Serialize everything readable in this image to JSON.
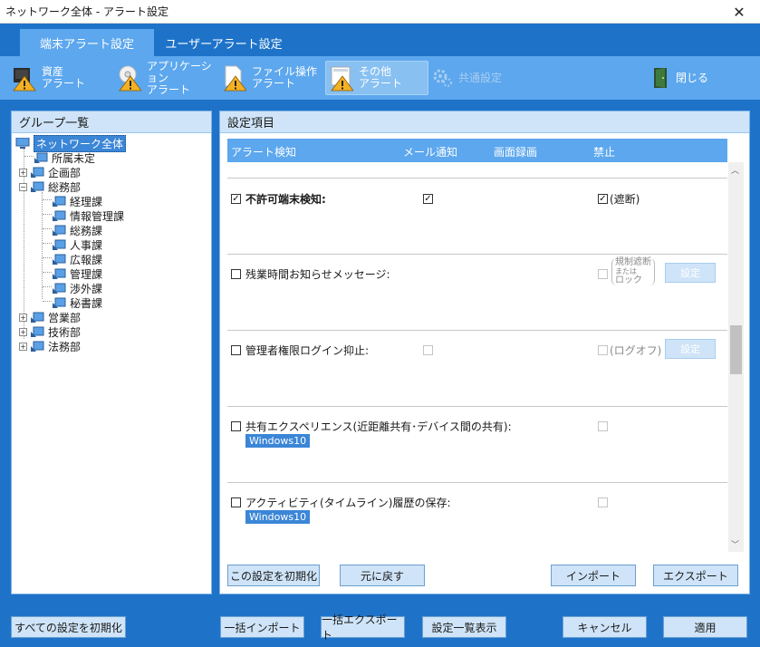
{
  "window": {
    "title": "ネットワーク全体 - アラート設定",
    "close_glyph": "✕"
  },
  "tabs": [
    {
      "label": "端末アラート設定",
      "active": true
    },
    {
      "label": "ユーザーアラート設定",
      "active": false
    }
  ],
  "toolbar": {
    "asset": {
      "line1": "資産",
      "line2": "アラート"
    },
    "application": {
      "line1": "アプリケーション",
      "line2": "アラート"
    },
    "file": {
      "line1": "ファイル操作",
      "line2": "アラート"
    },
    "other": {
      "line1": "その他",
      "line2": "アラート"
    },
    "common": {
      "label": "共通設定"
    },
    "close": {
      "label": "閉じる"
    }
  },
  "left_panel": {
    "title": "グループ一覧",
    "tree": {
      "root": "ネットワーク全体",
      "unassigned": "所属未定",
      "planning": "企画部",
      "general_affairs": "総務部",
      "children": [
        "経理課",
        "情報管理課",
        "総務課",
        "人事課",
        "広報課",
        "管理課",
        "渉外課",
        "秘書課"
      ],
      "sales": "営業部",
      "tech": "技術部",
      "legal": "法務部"
    }
  },
  "right_panel": {
    "title": "設定項目",
    "columns": {
      "alert": "アラート検知",
      "mail": "メール通知",
      "screen": "画面録画",
      "ban": "禁止"
    },
    "rows": [
      {
        "label": "不許可端末検知:",
        "checked": true,
        "mail": true,
        "ban": true,
        "ban_label": "(遮断)"
      },
      {
        "label": "残業時間お知らせメッセージ:",
        "checked": false,
        "lock_line1": "規制遮断",
        "lock_line2": "または",
        "lock_line3": "ロック",
        "button": "設定"
      },
      {
        "label": "管理者権限ログイン抑止:",
        "checked": false,
        "ban_label": "(ログオフ)",
        "button": "設定"
      },
      {
        "label": "共有エクスペリエンス(近距離共有･デバイス間の共有):",
        "checked": false,
        "badge": "Windows10"
      },
      {
        "label": "アクティビティ(タイムライン)履歴の保存:",
        "checked": false,
        "badge": "Windows10"
      }
    ],
    "buttons": {
      "reset": "この設定を初期化",
      "revert": "元に戻す",
      "import": "インポート",
      "export": "エクスポート"
    }
  },
  "footer": {
    "reset_all": "すべての設定を初期化",
    "bulk_import": "一括インポート",
    "bulk_export": "一括エクスポート",
    "list_view": "設定一覧表示",
    "cancel": "キャンセル",
    "apply": "適用"
  },
  "colors": {
    "window_blue": "#1e73c9",
    "toolbar_blue": "#5ca7ee",
    "panel_head": "#cfe4f8",
    "selected_blue": "#3b86d6"
  }
}
